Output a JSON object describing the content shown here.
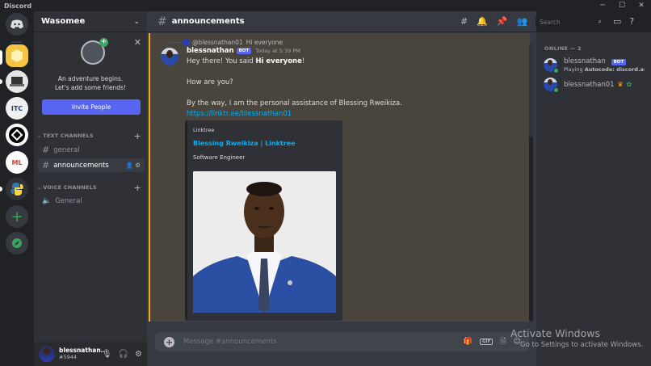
{
  "window": {
    "app_name": "Discord",
    "controls": [
      "─",
      "☐",
      "✕"
    ]
  },
  "server": {
    "name": "Wasomee",
    "onboarding_text_1": "An adventure begins.",
    "onboarding_text_2": "Let's add some friends!",
    "invite_button": "Invite People",
    "text_category": "TEXT CHANNELS",
    "voice_category": "VOICE CHANNELS",
    "text_channels": [
      "general",
      "announcements"
    ],
    "voice_channels": [
      "General"
    ]
  },
  "user_panel": {
    "username": "blessnathan...",
    "tag": "#5944"
  },
  "channel": {
    "name": "announcements"
  },
  "message": {
    "reply_author": "@blessnathan01",
    "reply_text": "Hi everyone",
    "author": "blessnathan",
    "bot_badge": "BOT",
    "timestamp": "Today at 5:39 PM",
    "line1_prefix": "Hey there! You said ",
    "line1_bold": "Hi everyone",
    "line1_suffix": "!",
    "line2": "How are you?",
    "line3": "By the way, I am the personal assistance of Blessing Rweikiza.",
    "link": "https://linktr.ee/blessnathan01"
  },
  "embed": {
    "provider": "Linktree",
    "title": "Blessing Rweikiza | Linktree",
    "description": "Software Engineer"
  },
  "composer": {
    "placeholder": "Message #announcements"
  },
  "search": {
    "placeholder": "Search"
  },
  "members": {
    "section": "ONLINE — 2",
    "list": [
      {
        "name": "blessnathan",
        "badge": "BOT",
        "activity_prefix": "Playing ",
        "activity": "Autocode: discord.aut..."
      },
      {
        "name": "blessnathan01",
        "badge": "",
        "activity_prefix": "",
        "activity": ""
      }
    ]
  },
  "watermark": {
    "line1": "Activate Windows",
    "line2": "Go to Settings to activate Windows."
  },
  "colors": {
    "accent": "#5865f2",
    "online": "#3ba55d",
    "mention": "#faa81a",
    "link": "#00aff4"
  }
}
